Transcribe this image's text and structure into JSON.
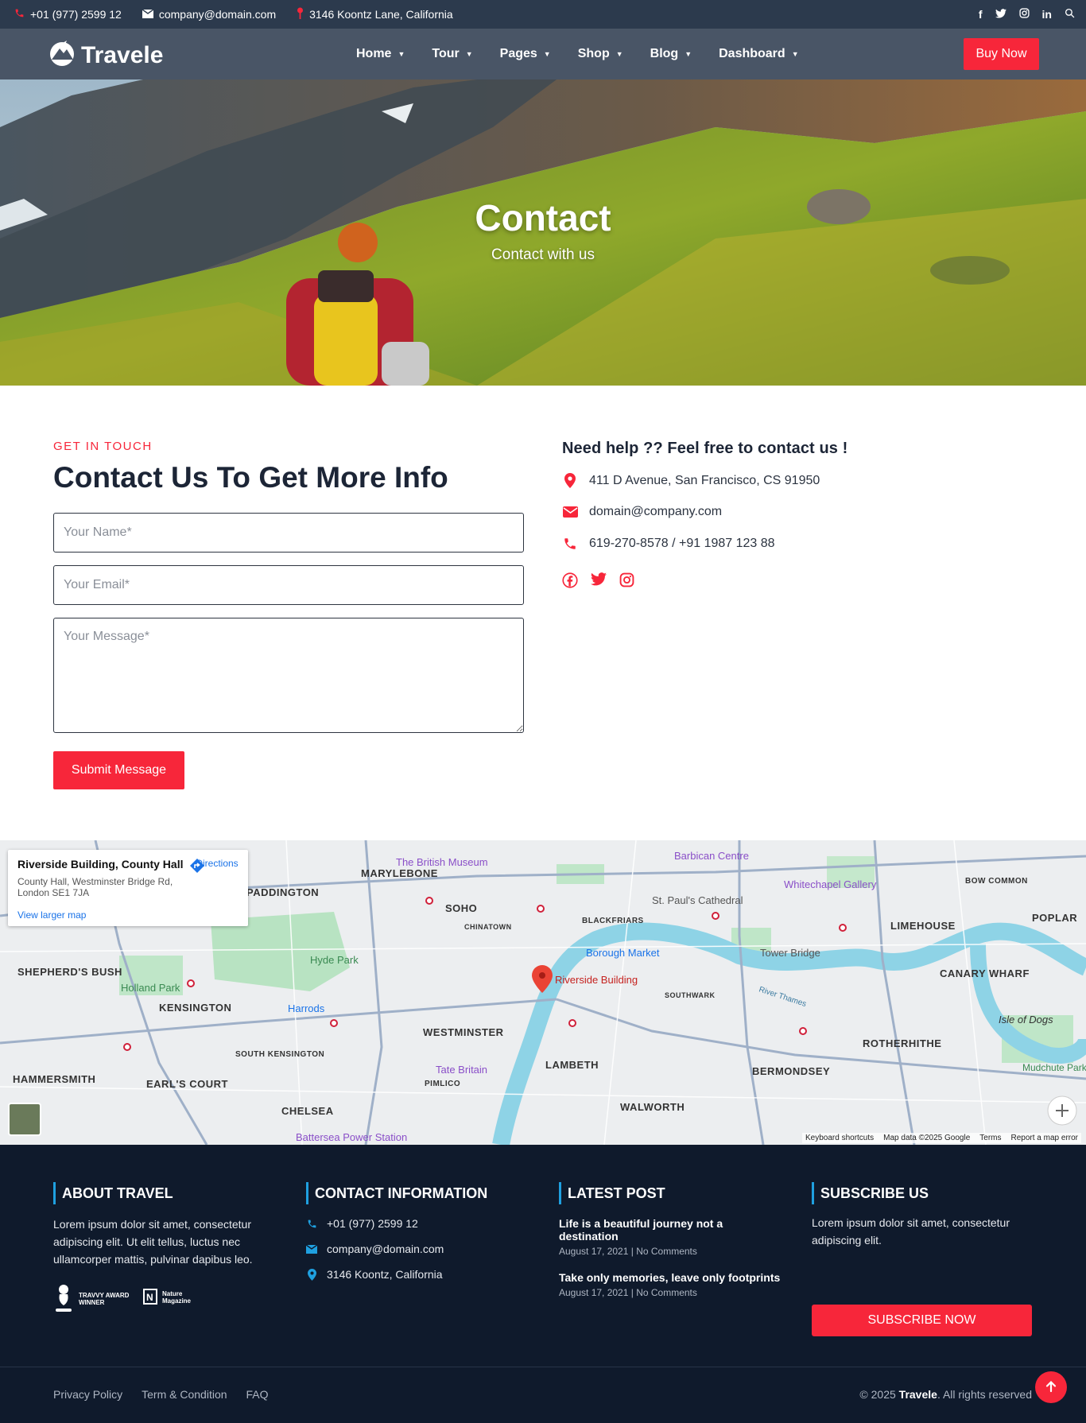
{
  "topbar": {
    "phone": "+01 (977) 2599 12",
    "email": "company@domain.com",
    "address": "3146 Koontz Lane, California"
  },
  "header": {
    "logo_text": "Travele",
    "nav": [
      {
        "label": "Home"
      },
      {
        "label": "Tour"
      },
      {
        "label": "Pages"
      },
      {
        "label": "Shop"
      },
      {
        "label": "Blog"
      },
      {
        "label": "Dashboard"
      }
    ],
    "buy_now": "Buy Now"
  },
  "hero": {
    "title": "Contact",
    "subtitle": "Contact with us"
  },
  "contact_form": {
    "eyebrow": "GET IN TOUCH",
    "title": "Contact Us To Get More Info",
    "name_placeholder": "Your Name*",
    "email_placeholder": "Your Email*",
    "message_placeholder": "Your Message*",
    "submit": "Submit Message"
  },
  "contact_info": {
    "heading": "Need help ?? Feel free to contact us !",
    "address": "411 D Avenue, San Francisco, CS 91950",
    "email": "domain@company.com",
    "phone": "619-270-8578 / +91 1987 123 88"
  },
  "map": {
    "place_name": "Riverside Building, County Hall",
    "place_address": "County Hall, Westminster Bridge Rd, London SE1 7JA",
    "directions": "Directions",
    "view_larger": "View larger map",
    "marker_label": "Riverside Building",
    "labels": {
      "marylebone": "MARYLEBONE",
      "paddington": "PADDINGTON",
      "soho": "SOHO",
      "chinatown": "CHINATOWN",
      "blackfriars": "BLACKFRIARS",
      "limehouse": "LIMEHOUSE",
      "poplar": "POPLAR",
      "canary_wharf": "CANARY WHARF",
      "bow_common": "BOW COMMON",
      "shepherds_bush": "SHEPHERD'S BUSH",
      "kensington": "KENSINGTON",
      "westminster": "WESTMINSTER",
      "lambeth": "LAMBETH",
      "south_kensington": "SOUTH KENSINGTON",
      "hammersmith": "HAMMERSMITH",
      "earls_court": "EARL'S COURT",
      "chelsea": "CHELSEA",
      "pimlico": "PIMLICO",
      "walworth": "WALWORTH",
      "bermondsey": "BERMONDSEY",
      "rotherhithe": "ROTHERHITHE",
      "southwark": "SOUTHWARK",
      "british_museum": "The British Museum",
      "barbican": "Barbican Centre",
      "whitechapel": "Whitechapel Gallery",
      "st_pauls": "St. Paul's Cathedral",
      "borough_market": "Borough Market",
      "tower_bridge": "Tower Bridge",
      "hyde_park": "Hyde Park",
      "holland_park": "Holland Park",
      "harrods": "Harrods",
      "tate_britain": "Tate Britain",
      "battersea": "Battersea Power Station",
      "isle_of_dogs": "Isle of Dogs",
      "mudchute": "Mudchute Park and Farm",
      "river_thames": "River Thames"
    },
    "attribution": {
      "shortcuts": "Keyboard shortcuts",
      "data": "Map data ©2025 Google",
      "terms": "Terms",
      "report": "Report a map error"
    }
  },
  "footer": {
    "about": {
      "heading": "ABOUT TRAVEL",
      "text": "Lorem ipsum dolor sit amet, consectetur adipiscing elit. Ut elit tellus, luctus nec ullamcorper mattis, pulvinar dapibus leo.",
      "award1_line1": "TRAVVY AWARD",
      "award1_line2": "WINNER",
      "award2_line1": "Nature",
      "award2_line2": "Magazine"
    },
    "contact": {
      "heading": "CONTACT INFORMATION",
      "phone": "+01 (977) 2599 12",
      "email": "company@domain.com",
      "address": "3146 Koontz, California"
    },
    "latest": {
      "heading": "LATEST POST",
      "posts": [
        {
          "title": "Life is a beautiful journey not a destination",
          "date": "August 17, 2021",
          "comments": "No Comments"
        },
        {
          "title": "Take only memories, leave only footprints",
          "date": "August 17, 2021",
          "comments": "No Comments"
        }
      ]
    },
    "subscribe": {
      "heading": "SUBSCRIBE US",
      "text": "Lorem ipsum dolor sit amet, consectetur adipiscing elit.",
      "button": "SUBSCRIBE NOW"
    },
    "links": [
      "Privacy Policy",
      "Term & Condition",
      "FAQ"
    ],
    "copyright_prefix": "© 2025",
    "copyright_brand": "Travele",
    "copyright_suffix": ". All rights reserved"
  },
  "colors": {
    "accent": "#f7263a",
    "topbar": "#2c3a4d",
    "header": "#495566",
    "footer": "#0f1a2c",
    "footer_accent": "#1fa0e0"
  }
}
